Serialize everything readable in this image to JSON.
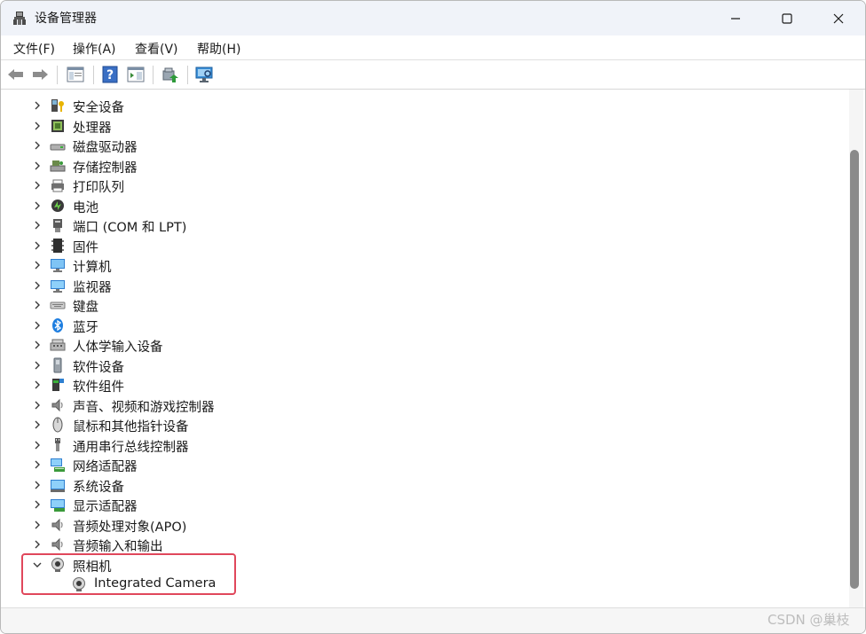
{
  "window": {
    "title": "设备管理器"
  },
  "menubar": {
    "items": [
      "文件(F)",
      "操作(A)",
      "查看(V)",
      "帮助(H)"
    ]
  },
  "toolbar": {
    "buttons": [
      "back-icon",
      "forward-icon",
      "properties-icon",
      "help-icon",
      "console-tree-icon",
      "update-driver-icon",
      "scan-hardware-icon"
    ]
  },
  "tree": {
    "items": [
      {
        "label": "安全设备",
        "icon": "security-device-icon",
        "expanded": false
      },
      {
        "label": "处理器",
        "icon": "processor-icon",
        "expanded": false
      },
      {
        "label": "磁盘驱动器",
        "icon": "disk-drive-icon",
        "expanded": false
      },
      {
        "label": "存储控制器",
        "icon": "storage-controller-icon",
        "expanded": false
      },
      {
        "label": "打印队列",
        "icon": "print-queue-icon",
        "expanded": false
      },
      {
        "label": "电池",
        "icon": "battery-icon",
        "expanded": false
      },
      {
        "label": "端口 (COM 和 LPT)",
        "icon": "port-icon",
        "expanded": false
      },
      {
        "label": "固件",
        "icon": "firmware-icon",
        "expanded": false
      },
      {
        "label": "计算机",
        "icon": "computer-icon",
        "expanded": false
      },
      {
        "label": "监视器",
        "icon": "monitor-icon",
        "expanded": false
      },
      {
        "label": "键盘",
        "icon": "keyboard-icon",
        "expanded": false
      },
      {
        "label": "蓝牙",
        "icon": "bluetooth-icon",
        "expanded": false
      },
      {
        "label": "人体学输入设备",
        "icon": "hid-icon",
        "expanded": false
      },
      {
        "label": "软件设备",
        "icon": "software-device-icon",
        "expanded": false
      },
      {
        "label": "软件组件",
        "icon": "software-component-icon",
        "expanded": false
      },
      {
        "label": "声音、视频和游戏控制器",
        "icon": "sound-icon",
        "expanded": false
      },
      {
        "label": "鼠标和其他指针设备",
        "icon": "mouse-icon",
        "expanded": false
      },
      {
        "label": "通用串行总线控制器",
        "icon": "usb-icon",
        "expanded": false
      },
      {
        "label": "网络适配器",
        "icon": "network-adapter-icon",
        "expanded": false
      },
      {
        "label": "系统设备",
        "icon": "system-device-icon",
        "expanded": false
      },
      {
        "label": "显示适配器",
        "icon": "display-adapter-icon",
        "expanded": false
      },
      {
        "label": "音频处理对象(APO)",
        "icon": "audio-apo-icon",
        "expanded": false
      },
      {
        "label": "音频输入和输出",
        "icon": "audio-io-icon",
        "expanded": false
      },
      {
        "label": "照相机",
        "icon": "camera-icon",
        "expanded": true
      },
      {
        "label": "Integrated Camera",
        "icon": "webcam-icon",
        "child": true
      }
    ]
  },
  "watermark": "CSDN @巢枝",
  "colors": {
    "titlebar": "#f0f3f9",
    "highlight": "#e0475b",
    "scrollthumb": "#8a8a8a"
  }
}
